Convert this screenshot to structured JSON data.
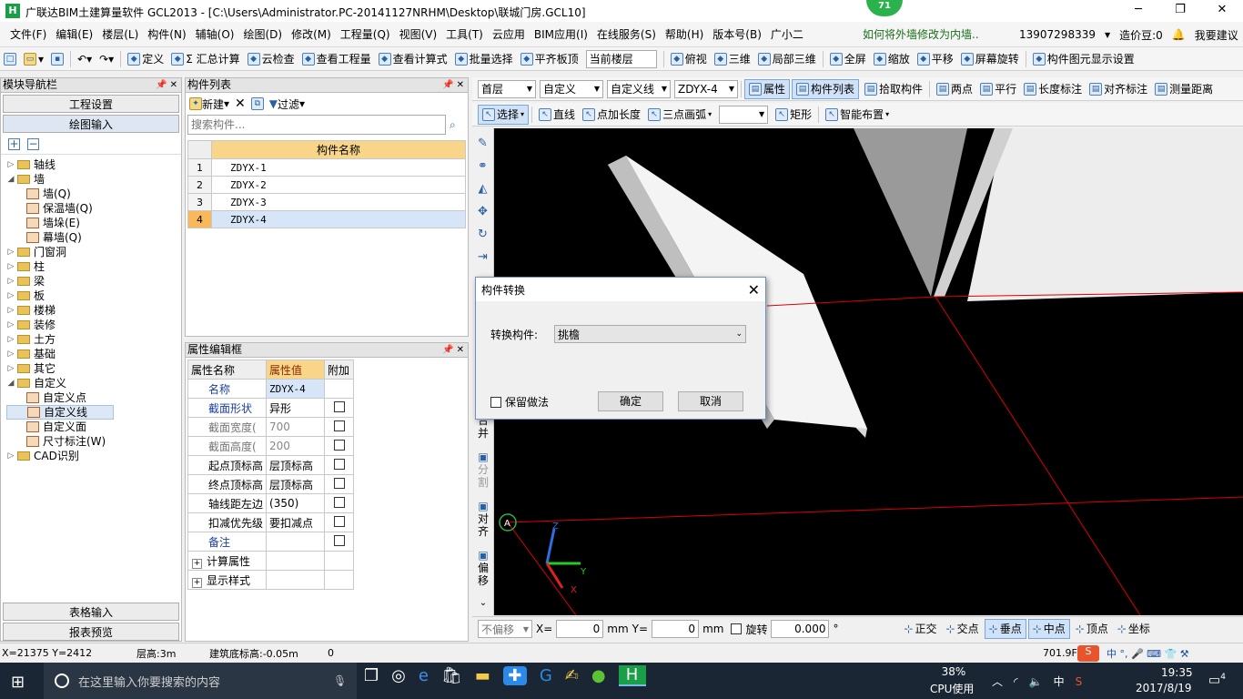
{
  "title": "广联达BIM土建算量软件 GCL2013 - [C:\\Users\\Administrator.PC-20141127NRHM\\Desktop\\联城门房.GCL10]",
  "badge": "71",
  "menu": [
    "文件(F)",
    "编辑(E)",
    "楼层(L)",
    "构件(N)",
    "辅轴(O)",
    "绘图(D)",
    "修改(M)",
    "工程量(Q)",
    "视图(V)",
    "工具(T)",
    "云应用",
    "BIM应用(I)",
    "在线服务(S)",
    "帮助(H)",
    "版本号(B)",
    "广小二"
  ],
  "menu_right": {
    "tip": "如何将外墙修改为内墙..",
    "phone": "13907298339",
    "coins": "造价豆:0",
    "suggest": "我要建议"
  },
  "toolbar1": [
    "定义",
    "Σ 汇总计算",
    "云检查",
    "查看工程量",
    "查看计算式",
    "批量选择",
    "平齐板顶",
    "当前楼层",
    "俯视",
    "三维",
    "局部三维",
    "全屏",
    "缩放",
    "平移",
    "屏幕旋转",
    "构件图元显示设置"
  ],
  "toolbar2": {
    "floor": "首层",
    "cat": "自定义",
    "sub": "自定义线",
    "comp": "ZDYX-4",
    "items": [
      "属性",
      "构件列表",
      "拾取构件",
      "两点",
      "平行",
      "长度标注",
      "对齐标注",
      "测量距离"
    ]
  },
  "toolbar3": [
    "选择",
    "直线",
    "点加长度",
    "三点画弧",
    "矩形",
    "智能布置"
  ],
  "nav": {
    "title": "模块导航栏",
    "btn1": "工程设置",
    "btn2": "绘图输入",
    "btn3": "表格输入",
    "btn4": "报表预览",
    "tree": [
      {
        "l": "轴线",
        "lvl": 0,
        "t": "f",
        "e": "+"
      },
      {
        "l": "墙",
        "lvl": 0,
        "t": "f",
        "e": "-"
      },
      {
        "l": "墙(Q)",
        "lvl": 1,
        "t": "i"
      },
      {
        "l": "保温墙(Q)",
        "lvl": 1,
        "t": "i"
      },
      {
        "l": "墙垛(E)",
        "lvl": 1,
        "t": "i"
      },
      {
        "l": "幕墙(Q)",
        "lvl": 1,
        "t": "i"
      },
      {
        "l": "门窗洞",
        "lvl": 0,
        "t": "f",
        "e": "+"
      },
      {
        "l": "柱",
        "lvl": 0,
        "t": "f",
        "e": "+"
      },
      {
        "l": "梁",
        "lvl": 0,
        "t": "f",
        "e": "+"
      },
      {
        "l": "板",
        "lvl": 0,
        "t": "f",
        "e": "+"
      },
      {
        "l": "楼梯",
        "lvl": 0,
        "t": "f",
        "e": "+"
      },
      {
        "l": "装修",
        "lvl": 0,
        "t": "f",
        "e": "+"
      },
      {
        "l": "土方",
        "lvl": 0,
        "t": "f",
        "e": "+"
      },
      {
        "l": "基础",
        "lvl": 0,
        "t": "f",
        "e": "+"
      },
      {
        "l": "其它",
        "lvl": 0,
        "t": "f",
        "e": "+"
      },
      {
        "l": "自定义",
        "lvl": 0,
        "t": "f",
        "e": "-"
      },
      {
        "l": "自定义点",
        "lvl": 1,
        "t": "i"
      },
      {
        "l": "自定义线",
        "lvl": 1,
        "t": "i",
        "sel": true
      },
      {
        "l": "自定义面",
        "lvl": 1,
        "t": "i"
      },
      {
        "l": "尺寸标注(W)",
        "lvl": 1,
        "t": "i"
      },
      {
        "l": "CAD识别",
        "lvl": 0,
        "t": "f",
        "e": "+"
      }
    ]
  },
  "complist": {
    "title": "构件列表",
    "new": "新建",
    "filter": "过滤",
    "search_ph": "搜索构件...",
    "col": "构件名称",
    "rows": [
      {
        "n": "1",
        "v": "ZDYX-1"
      },
      {
        "n": "2",
        "v": "ZDYX-2"
      },
      {
        "n": "3",
        "v": "ZDYX-3"
      },
      {
        "n": "4",
        "v": "ZDYX-4"
      }
    ]
  },
  "props": {
    "title": "属性编辑框",
    "h1": "属性名称",
    "h2": "属性值",
    "h3": "附加",
    "rows": [
      {
        "k": "名称",
        "v": "ZDYX-4",
        "c": "blue",
        "chk": false
      },
      {
        "k": "截面形状",
        "v": "异形",
        "c": "blue",
        "chk": true
      },
      {
        "k": "截面宽度(",
        "v": "700",
        "c": "gray",
        "chk": true
      },
      {
        "k": "截面高度(",
        "v": "200",
        "c": "gray",
        "chk": true
      },
      {
        "k": "起点顶标高",
        "v": "层顶标高",
        "c": "black",
        "chk": true
      },
      {
        "k": "终点顶标高",
        "v": "层顶标高",
        "c": "black",
        "chk": true
      },
      {
        "k": "轴线距左边",
        "v": "(350)",
        "c": "black",
        "chk": true
      },
      {
        "k": "扣减优先级",
        "v": "要扣减点",
        "c": "black",
        "chk": true
      },
      {
        "k": "备注",
        "v": "",
        "c": "blue",
        "chk": true
      },
      {
        "k": "计算属性",
        "v": "",
        "c": "black",
        "chk": false,
        "exp": true
      },
      {
        "k": "显示样式",
        "v": "",
        "c": "black",
        "chk": false,
        "exp": true
      }
    ]
  },
  "vbar": [
    "合并",
    "分割",
    "对齐",
    "偏移"
  ],
  "dialog": {
    "title": "构件转换",
    "label": "转换构件:",
    "value": "挑檐",
    "keep": "保留做法",
    "ok": "确定",
    "cancel": "取消"
  },
  "bottombar": {
    "offset": "不偏移",
    "x": "X=",
    "xv": "0",
    "mm1": "mm",
    "y": "Y=",
    "yv": "0",
    "mm2": "mm",
    "rotate": "旋转",
    "rv": "0.000",
    "deg": "°",
    "snaps": [
      "正交",
      "交点",
      "垂点",
      "中点",
      "顶点",
      "坐标"
    ]
  },
  "status": {
    "coords": "X=21375 Y=2412",
    "floor_h": "层高:3m",
    "base": "建筑底标高:-0.05m",
    "n": "0",
    "right": "701.9F"
  },
  "taskbar": {
    "search": "在这里输入你要搜索的内容",
    "cpu": "38%",
    "cpu_label": "CPU使用",
    "ime": "中",
    "time": "19:35",
    "date": "2017/8/19",
    "notif": "4"
  }
}
